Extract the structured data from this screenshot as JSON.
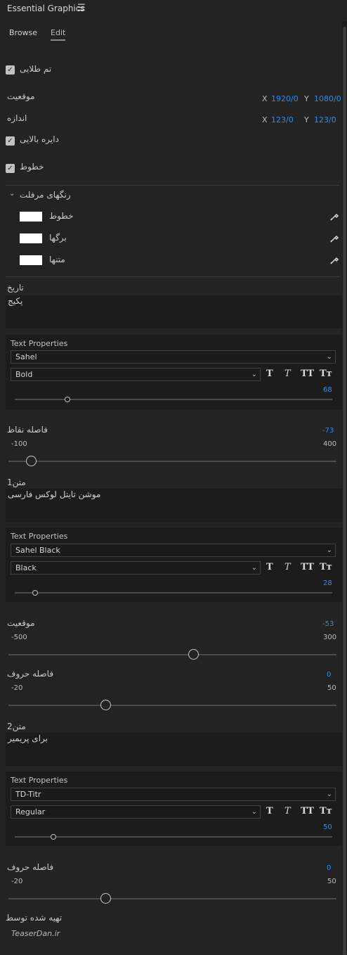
{
  "header": {
    "title": "Essential Graphics",
    "menu_icon": "☰"
  },
  "tabs": [
    {
      "label": "Browse"
    },
    {
      "label": "Edit"
    }
  ],
  "props": {
    "gold_theme": {
      "label": "تم طلایی",
      "checked": true
    },
    "position": {
      "label": "موقعیت",
      "x_label": "X",
      "x": "1920/0",
      "y_label": "Y",
      "y": "1080/0"
    },
    "size": {
      "label": "اندازه",
      "x_label": "X",
      "x": "123/0",
      "y_label": "Y",
      "y": "123/0"
    },
    "top_circle": {
      "label": "دایره بالایی",
      "checked": true
    },
    "lines": {
      "label": "خطوط",
      "checked": true
    }
  },
  "colors_group": {
    "label": "رنگهای مرفلت",
    "items": [
      {
        "label": "خطوط",
        "color": "#ffffff"
      },
      {
        "label": "برگها",
        "color": "#ffffff"
      },
      {
        "label": "متنها",
        "color": "#ffffff"
      }
    ]
  },
  "date_section": {
    "label": "تاریخ",
    "value": "پکیج"
  },
  "tp1": {
    "title": "Text Properties",
    "font": "Sahel",
    "style": "Bold",
    "size": "68",
    "buttons": [
      "T",
      "T",
      "TT",
      "Tт"
    ]
  },
  "dot_spacing": {
    "label": "فاصله نقاط",
    "value": "-73",
    "min": "-100",
    "max": "400"
  },
  "text1": {
    "label": "متن1",
    "value": "موشن تایتل لوکس فارسی"
  },
  "tp2": {
    "title": "Text Properties",
    "font": "Sahel Black",
    "style": "Black",
    "size": "28",
    "buttons": [
      "T",
      "T",
      "TT",
      "Tт"
    ]
  },
  "position2": {
    "label": "موقعیت",
    "value": "-53",
    "min": "-500",
    "max": "300"
  },
  "letter_spacing1": {
    "label": "فاصله حروف",
    "value": "0",
    "min": "-20",
    "max": "50"
  },
  "text2": {
    "label": "متن2",
    "value": "برای پریمیر"
  },
  "tp3": {
    "title": "Text Properties",
    "font": "TD-Titr",
    "style": "Regular",
    "size": "50",
    "buttons": [
      "T",
      "T",
      "TT",
      "Tт"
    ]
  },
  "letter_spacing2": {
    "label": "فاصله حروف",
    "value": "0",
    "min": "-20",
    "max": "50"
  },
  "footer": {
    "label": "تهیه شده توسط",
    "credit": "TeaserDan.ir"
  },
  "colors": {
    "accent": "#2d8ceb",
    "bg": "#232323",
    "panel": "#1c1c1c"
  }
}
